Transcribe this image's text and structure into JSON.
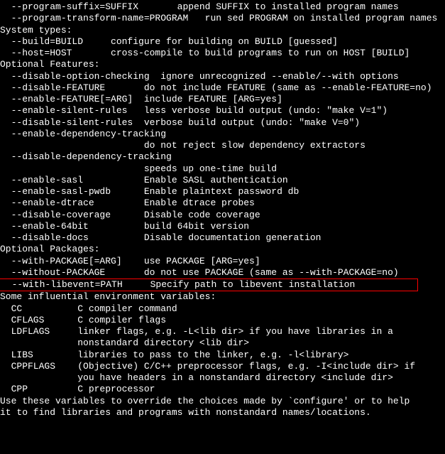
{
  "lines": [
    {
      "text": "  --program-suffix=SUFFIX       append SUFFIX to installed program names"
    },
    {
      "text": "  --program-transform-name=PROGRAM   run sed PROGRAM on installed program names"
    },
    {
      "text": ""
    },
    {
      "text": "System types:"
    },
    {
      "text": "  --build=BUILD     configure for building on BUILD [guessed]"
    },
    {
      "text": "  --host=HOST       cross-compile to build programs to run on HOST [BUILD]"
    },
    {
      "text": ""
    },
    {
      "text": "Optional Features:"
    },
    {
      "text": "  --disable-option-checking  ignore unrecognized --enable/--with options"
    },
    {
      "text": "  --disable-FEATURE       do not include FEATURE (same as --enable-FEATURE=no)"
    },
    {
      "text": "  --enable-FEATURE[=ARG]  include FEATURE [ARG=yes]"
    },
    {
      "text": "  --enable-silent-rules   less verbose build output (undo: \"make V=1\")"
    },
    {
      "text": "  --disable-silent-rules  verbose build output (undo: \"make V=0\")"
    },
    {
      "text": "  --enable-dependency-tracking"
    },
    {
      "text": "                          do not reject slow dependency extractors"
    },
    {
      "text": "  --disable-dependency-tracking"
    },
    {
      "text": "                          speeds up one-time build"
    },
    {
      "text": "  --enable-sasl           Enable SASL authentication"
    },
    {
      "text": "  --enable-sasl-pwdb      Enable plaintext password db"
    },
    {
      "text": "  --enable-dtrace         Enable dtrace probes"
    },
    {
      "text": "  --disable-coverage      Disable code coverage"
    },
    {
      "text": "  --enable-64bit          build 64bit version"
    },
    {
      "text": "  --disable-docs          Disable documentation generation"
    },
    {
      "text": ""
    },
    {
      "text": "Optional Packages:"
    },
    {
      "text": "  --with-PACKAGE[=ARG]    use PACKAGE [ARG=yes]"
    },
    {
      "text": "  --without-PACKAGE       do not use PACKAGE (same as --with-PACKAGE=no)"
    },
    {
      "text": "  --with-libevent=PATH     Specify path to libevent installation           ",
      "highlight": true
    },
    {
      "text": ""
    },
    {
      "text": "Some influential environment variables:"
    },
    {
      "text": "  CC          C compiler command"
    },
    {
      "text": "  CFLAGS      C compiler flags"
    },
    {
      "text": "  LDFLAGS     linker flags, e.g. -L<lib dir> if you have libraries in a"
    },
    {
      "text": "              nonstandard directory <lib dir>"
    },
    {
      "text": "  LIBS        libraries to pass to the linker, e.g. -l<library>"
    },
    {
      "text": "  CPPFLAGS    (Objective) C/C++ preprocessor flags, e.g. -I<include dir> if"
    },
    {
      "text": "              you have headers in a nonstandard directory <include dir>"
    },
    {
      "text": "  CPP         C preprocessor"
    },
    {
      "text": ""
    },
    {
      "text": "Use these variables to override the choices made by `configure' or to help"
    },
    {
      "text": "it to find libraries and programs with nonstandard names/locations."
    }
  ]
}
